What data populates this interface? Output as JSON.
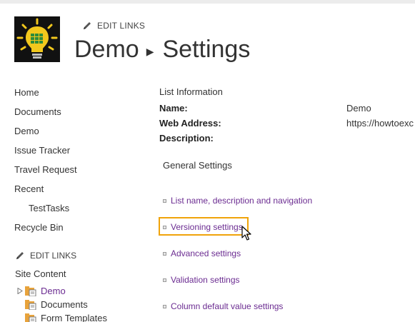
{
  "header": {
    "edit_links": "EDIT LINKS",
    "breadcrumb_site": "Demo",
    "breadcrumb_page": "Settings"
  },
  "left_nav": {
    "items": [
      {
        "label": "Home"
      },
      {
        "label": "Documents"
      },
      {
        "label": "Demo"
      },
      {
        "label": "Issue Tracker"
      },
      {
        "label": "Travel Request"
      },
      {
        "label": "Recent"
      },
      {
        "label": "TestTasks"
      },
      {
        "label": "Recycle Bin"
      }
    ],
    "edit_links": "EDIT LINKS",
    "site_content": "Site Content",
    "tree": [
      {
        "label": "Demo"
      },
      {
        "label": "Documents"
      },
      {
        "label": "Form Templates"
      }
    ]
  },
  "list_info": {
    "heading": "List Information",
    "name_label": "Name:",
    "name_value": "Demo",
    "web_address_label": "Web Address:",
    "web_address_value": "https://howtoexc",
    "description_label": "Description:"
  },
  "general_settings": {
    "heading": "General Settings",
    "links": [
      "List name, description and navigation",
      "Versioning settings",
      "Advanced settings",
      "Validation settings",
      "Column default value settings"
    ]
  },
  "colors": {
    "link": "#6b2c91",
    "highlight": "#f0a30a",
    "logo_bg": "#111111",
    "logo_bulb": "#f2c81d"
  }
}
